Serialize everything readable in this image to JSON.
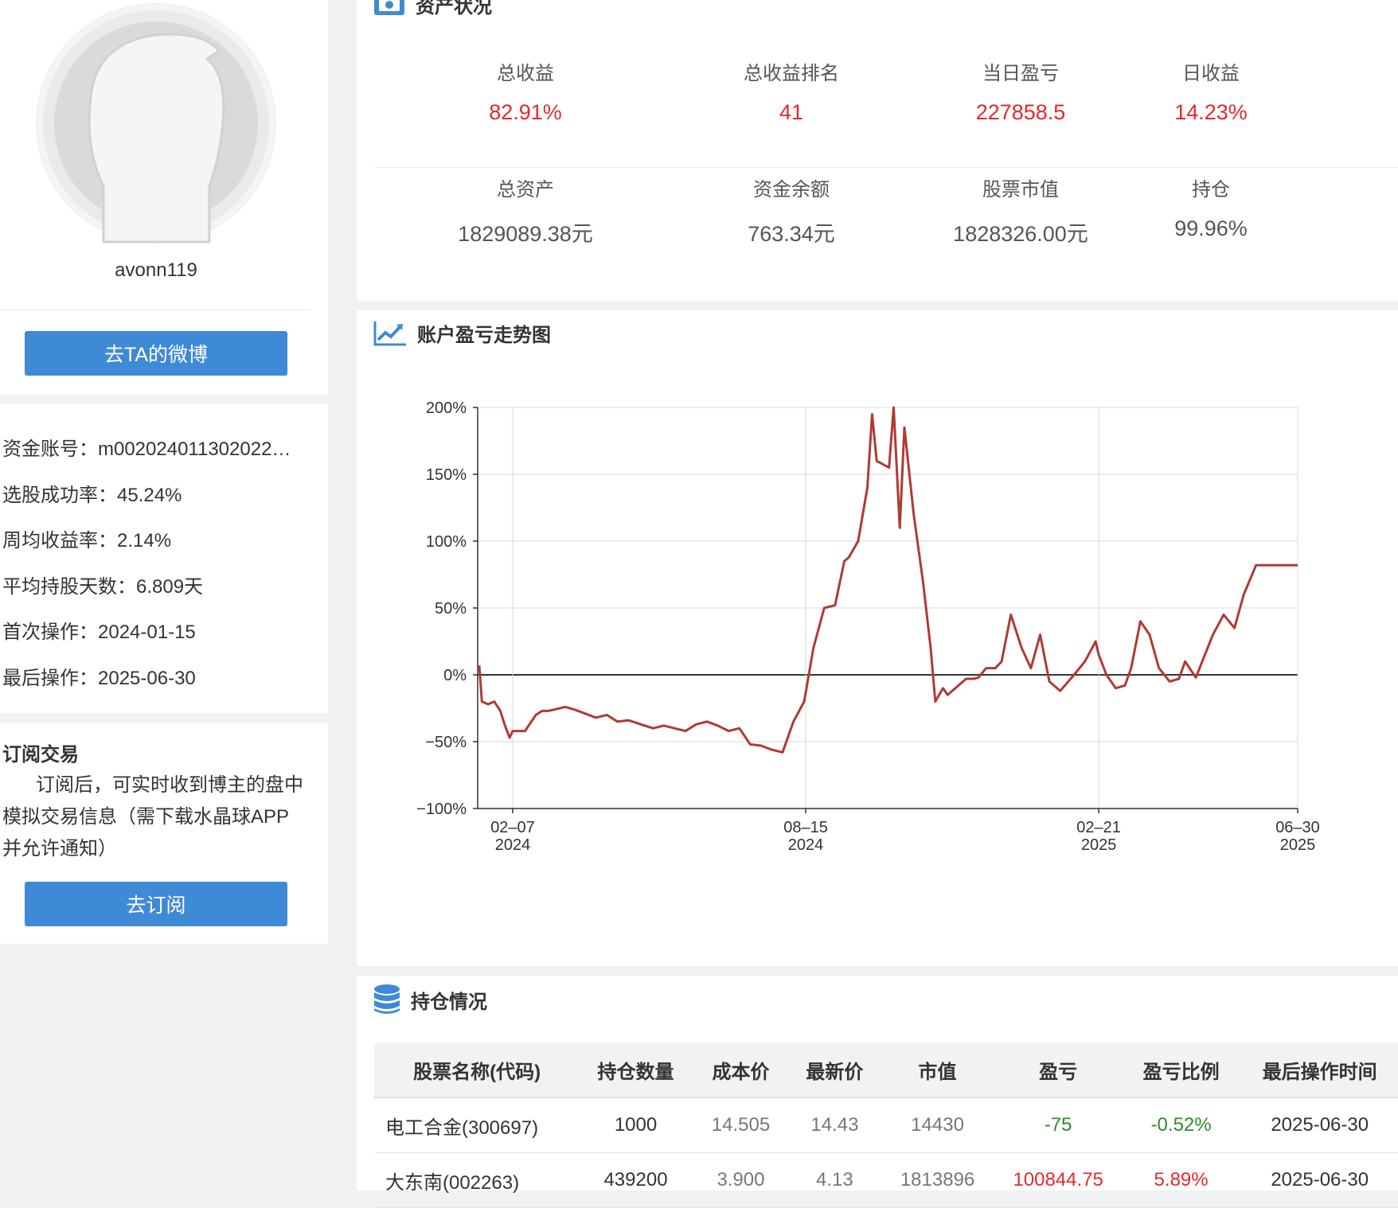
{
  "profile": {
    "username": "avonn119",
    "weibo_button": "去TA的微博"
  },
  "stats": {
    "account": "资金账号：m002024011302022…",
    "success_rate": "选股成功率：45.24%",
    "weekly_return": "周均收益率：2.14%",
    "avg_hold_days": "平均持股天数：6.809天",
    "first_op": "首次操作：2024-01-15",
    "last_op": "最后操作：2025-06-30"
  },
  "subscribe": {
    "title": "订阅交易",
    "desc": "订阅后，可实时收到博主的盘中模拟交易信息（需下载水晶球APP并允许通知）",
    "button": "去订阅"
  },
  "asset": {
    "title": "资产状况",
    "row1": [
      {
        "label": "总收益",
        "value": "82.91%"
      },
      {
        "label": "总收益排名",
        "value": "41"
      },
      {
        "label": "当日盈亏",
        "value": "227858.5"
      },
      {
        "label": "日收益",
        "value": "14.23%"
      }
    ],
    "row2": [
      {
        "label": "总资产",
        "value": "1829089.38元"
      },
      {
        "label": "资金余额",
        "value": "763.34元"
      },
      {
        "label": "股票市值",
        "value": "1828326.00元"
      },
      {
        "label": "持仓",
        "value": "99.96%"
      }
    ],
    "colors": {
      "up": "#e5292b",
      "neutral": "#555555"
    }
  },
  "chart_section": {
    "title": "账户盈亏走势图"
  },
  "chart_data": {
    "type": "line",
    "title": "",
    "xlabel": "",
    "ylabel": "",
    "ylim": [
      -100,
      200
    ],
    "yticks": [
      "200%",
      "150%",
      "100%",
      "50%",
      "0%",
      "−50%",
      "−100%"
    ],
    "ytick_values": [
      200,
      150,
      100,
      50,
      0,
      -50,
      -100
    ],
    "xticks": [
      {
        "date": "2024-02-07",
        "line1": "02–07",
        "line2": "2024"
      },
      {
        "date": "2024-08-15",
        "line1": "08–15",
        "line2": "2024"
      },
      {
        "date": "2025-02-21",
        "line1": "02–21",
        "line2": "2025"
      },
      {
        "date": "2025-06-30",
        "line1": "06–30",
        "line2": "2025"
      }
    ],
    "grid": true,
    "line_color": "#b03a34",
    "series": [
      {
        "x": [
          "2024-01-15",
          "2024-01-18",
          "2024-01-22",
          "2024-01-26",
          "2024-01-30",
          "2024-02-02",
          "2024-02-05",
          "2024-02-07",
          "2024-02-15",
          "2024-02-22",
          "2024-02-26",
          "2024-03-01",
          "2024-03-05",
          "2024-03-12",
          "2024-03-18",
          "2024-03-25",
          "2024-04-01",
          "2024-04-08",
          "2024-04-15",
          "2024-04-22",
          "2024-04-30",
          "2024-05-08",
          "2024-05-15",
          "2024-05-22",
          "2024-05-29",
          "2024-06-05",
          "2024-06-12",
          "2024-06-19",
          "2024-06-26",
          "2024-07-03",
          "2024-07-10",
          "2024-07-17",
          "2024-07-24",
          "2024-07-31",
          "2024-08-07",
          "2024-08-14",
          "2024-08-20",
          "2024-08-27",
          "2024-09-03",
          "2024-09-09",
          "2024-09-12",
          "2024-09-18",
          "2024-09-24",
          "2024-09-27",
          "2024-09-30",
          "2024-10-08",
          "2024-10-11",
          "2024-10-15",
          "2024-10-18",
          "2024-10-24",
          "2024-10-30",
          "2024-11-04",
          "2024-11-07",
          "2024-11-12",
          "2024-11-15",
          "2024-11-20",
          "2024-11-25",
          "2024-11-27",
          "2024-12-02",
          "2024-12-05",
          "2024-12-10",
          "2024-12-16",
          "2024-12-20",
          "2024-12-26",
          "2025-01-02",
          "2025-01-08",
          "2025-01-14",
          "2025-01-20",
          "2025-01-27",
          "2025-02-05",
          "2025-02-12",
          "2025-02-19",
          "2025-02-21",
          "2025-02-26",
          "2025-03-04",
          "2025-03-10",
          "2025-03-14",
          "2025-03-20",
          "2025-03-26",
          "2025-04-01",
          "2025-04-08",
          "2025-04-14",
          "2025-04-18",
          "2025-04-25",
          "2025-05-06",
          "2025-05-13",
          "2025-05-20",
          "2025-05-26",
          "2025-06-03",
          "2025-06-10",
          "2025-06-16",
          "2025-06-20",
          "2025-06-25",
          "2025-06-30"
        ],
        "y": [
          7,
          -20,
          -22,
          -20,
          -27,
          -38,
          -47,
          -42,
          -42,
          -30,
          -27,
          -27,
          -26,
          -24,
          -26,
          -29,
          -32,
          -30,
          -35,
          -34,
          -37,
          -40,
          -38,
          -40,
          -42,
          -37,
          -35,
          -38,
          -42,
          -40,
          -52,
          -53,
          -56,
          -58,
          -35,
          -20,
          20,
          50,
          52,
          85,
          88,
          100,
          140,
          195,
          160,
          155,
          200,
          110,
          185,
          120,
          70,
          20,
          -20,
          -10,
          -15,
          -10,
          -5,
          -3,
          -3,
          -2,
          5,
          5,
          10,
          45,
          20,
          5,
          30,
          -5,
          -12,
          0,
          10,
          25,
          15,
          0,
          -10,
          -8,
          5,
          40,
          30,
          5,
          -5,
          -3,
          10,
          -2,
          30,
          45,
          35,
          60,
          82,
          82,
          82,
          82,
          82,
          82
        ]
      }
    ]
  },
  "holdings": {
    "title": "持仓情况",
    "headers": [
      "股票名称(代码)",
      "持仓数量",
      "成本价",
      "最新价",
      "市值",
      "盈亏",
      "盈亏比例",
      "最后操作时间"
    ],
    "rows": [
      [
        "电工合金(300697)",
        "1000",
        "14.505",
        "14.43",
        "14430",
        "-75",
        "-0.52%",
        "2025-06-30"
      ],
      [
        "大东南(002263)",
        "439200",
        "3.900",
        "4.13",
        "1813896",
        "100844.75",
        "5.89%",
        "2025-06-30"
      ]
    ],
    "colors": {
      "name": "#8a5a14",
      "loss": "#2e8b2e",
      "gain": "#e5292b"
    }
  },
  "icons": {
    "asset": "money-icon",
    "chart": "trend-line-icon",
    "holdings": "database-icon"
  }
}
